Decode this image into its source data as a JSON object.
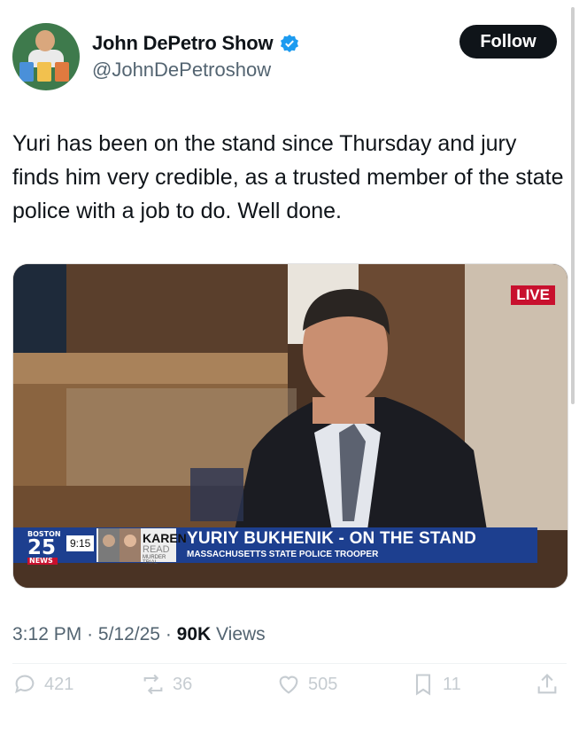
{
  "author": {
    "name": "John DePetro Show",
    "handle": "@JohnDePetroshow",
    "verified_color": "#1d9bf0"
  },
  "follow_label": "Follow",
  "tweet_text": "Yuri has been on the stand since Thursday and jury finds him very credible, as a trusted member of the state police with a job to do. Well done.",
  "media": {
    "live_label": "LIVE",
    "station": "BOSTON",
    "channel": "25",
    "news_label": "NEWS",
    "time": "9:15",
    "segment_name": "KAREN",
    "segment_sub": "READ",
    "segment_tag": "MURDER TRIAL",
    "headline": "YURIY BUKHENIK - ON THE STAND",
    "subheadline": "MASSACHUSETTS STATE POLICE TROOPER"
  },
  "meta": {
    "time": "3:12 PM",
    "date": "5/12/25",
    "views_count": "90K",
    "views_label": "Views",
    "dot": "·"
  },
  "actions": {
    "replies": "421",
    "reposts": "36",
    "likes": "505",
    "bookmarks": "11"
  }
}
